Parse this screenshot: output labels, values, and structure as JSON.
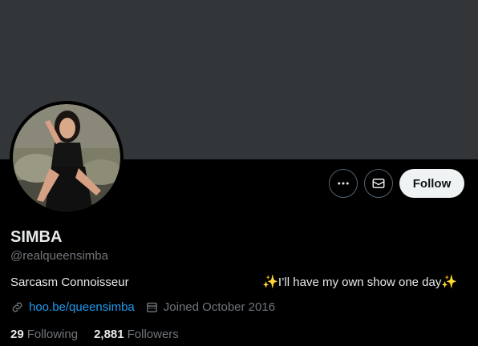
{
  "profile": {
    "name": "SIMBA",
    "handle": "@realqueensimba",
    "bio_left": "Sarcasm Connoisseur",
    "bio_right_text": "I’ll have my own show one day",
    "sparkle": "✨",
    "link": "hoo.be/queensimba",
    "joined": "Joined October 2016",
    "following_count": "29",
    "following_label": "Following",
    "followers_count": "2,881",
    "followers_label": "Followers"
  },
  "actions": {
    "more_icon": "more-dots-icon",
    "message_icon": "envelope-icon",
    "follow_label": "Follow"
  },
  "colors": {
    "banner": "#333639",
    "link": "#1d9bf0",
    "muted": "#71767b",
    "follow_bg": "#eff3f4"
  }
}
